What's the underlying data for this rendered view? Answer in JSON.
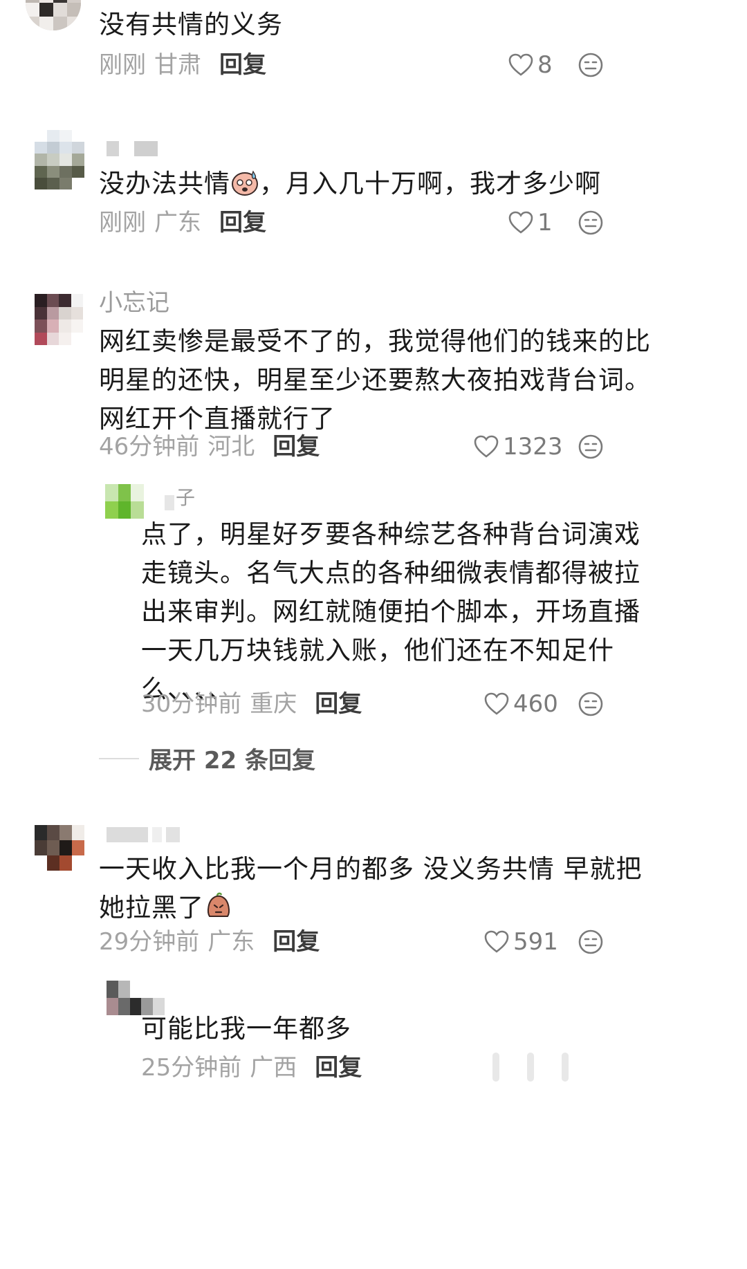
{
  "colors": {
    "text": "#1a1a1a",
    "meta": "#a3a3a3",
    "reply": "#3c3c3c",
    "icon": "#7a7a7a"
  },
  "icons": {
    "like": "heart-outline-icon",
    "react": "neutral-face-icon"
  },
  "comments": [
    {
      "name": "",
      "text": "没有共情的义务",
      "time": "刚刚",
      "location": "甘肃",
      "reply": "回复",
      "likes": "8"
    },
    {
      "name": "",
      "text_before": "没办法共情",
      "text_after": "，月入几十万啊，我才多少啊",
      "time": "刚刚",
      "location": "广东",
      "reply": "回复",
      "likes": "1"
    },
    {
      "name": "小忘记",
      "text_lines": [
        "网红卖惨是最受不了的，我觉得他们的钱来的比",
        "明星的还快，明星至少还要熬大夜拍戏背台词。",
        "网红开个直播就行了"
      ],
      "time": "46分钟前",
      "location": "河北",
      "reply": "回复",
      "likes": "1323",
      "sub": {
        "name": "子",
        "text_lines": [
          "点了，明星好歹要各种综艺各种背台词演戏",
          "走镜头。名气大点的各种细微表情都得被拉",
          "出来审判。网红就随便拍个脚本，开场直播",
          "一天几万块钱就入账，他们还在不知足什",
          "么、、、、"
        ],
        "time": "30分钟前",
        "location": "重庆",
        "reply": "回复",
        "likes": "460"
      },
      "expand": "展开 22 条回复"
    },
    {
      "name": "",
      "text_line1": "一天收入比我一个月的都多 没义务共情 早就把",
      "text_line2": "她拉黑了",
      "time": "29分钟前",
      "location": "广东",
      "reply": "回复",
      "likes": "591",
      "sub": {
        "name": "",
        "text": "可能比我一年都多",
        "time": "25分钟前",
        "location": "广西",
        "reply": "回复"
      }
    }
  ]
}
